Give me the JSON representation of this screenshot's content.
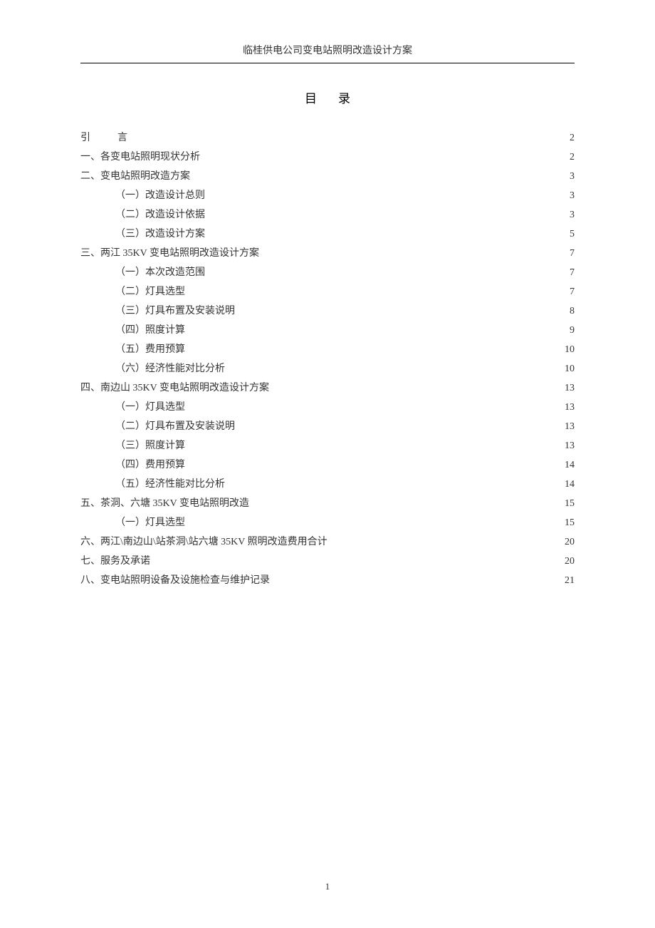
{
  "header": "临桂供电公司变电站照明改造设计方案",
  "title": "目录",
  "page_number": "1",
  "toc": [
    {
      "level": 1,
      "label_html": "引<span class=\"spaced\">　</span>言",
      "page": "2"
    },
    {
      "level": 1,
      "label": "一、各变电站照明现状分析",
      "page": "2"
    },
    {
      "level": 1,
      "label": "二、变电站照明改造方案",
      "page": "3"
    },
    {
      "level": 2,
      "label": "（一）改造设计总则",
      "page": "3"
    },
    {
      "level": 2,
      "label": "（二）改造设计依据",
      "page": "3"
    },
    {
      "level": 2,
      "label": "（三）改造设计方案",
      "page": "5"
    },
    {
      "level": 1,
      "label": "三、两江 35KV 变电站照明改造设计方案",
      "page": "7"
    },
    {
      "level": 2,
      "label": "（一）本次改造范围",
      "page": "7"
    },
    {
      "level": 2,
      "label": "（二）灯具选型",
      "page": "7"
    },
    {
      "level": 2,
      "label": "（三）灯具布置及安装说明",
      "page": "8"
    },
    {
      "level": 2,
      "label": "（四）照度计算",
      "page": "9"
    },
    {
      "level": 2,
      "label": "（五）费用预算",
      "page": "10"
    },
    {
      "level": 2,
      "label": "（六）经济性能对比分析",
      "page": "10"
    },
    {
      "level": 1,
      "label": "四、南边山 35KV 变电站照明改造设计方案",
      "page": "13"
    },
    {
      "level": 2,
      "label": "（一）灯具选型",
      "page": "13"
    },
    {
      "level": 2,
      "label": "（二）灯具布置及安装说明",
      "page": "13"
    },
    {
      "level": 2,
      "label": "（三）照度计算",
      "page": "13"
    },
    {
      "level": 2,
      "label": "（四）费用预算",
      "page": "14"
    },
    {
      "level": 2,
      "label": "（五）经济性能对比分析",
      "page": "14"
    },
    {
      "level": 1,
      "label": "五、茶洞、六塘 35KV 变电站照明改造",
      "page": "15"
    },
    {
      "level": 2,
      "label": "（一）灯具选型",
      "page": "15"
    },
    {
      "level": 1,
      "label": "六、两江\\南边山\\站茶洞\\站六塘 35KV 照明改造费用合计",
      "page": "20",
      "special": true
    },
    {
      "level": 1,
      "label": "七、服务及承诺",
      "page": "20"
    },
    {
      "level": 1,
      "label": "八、变电站照明设备及设施检查与维护记录",
      "page": "21"
    }
  ]
}
